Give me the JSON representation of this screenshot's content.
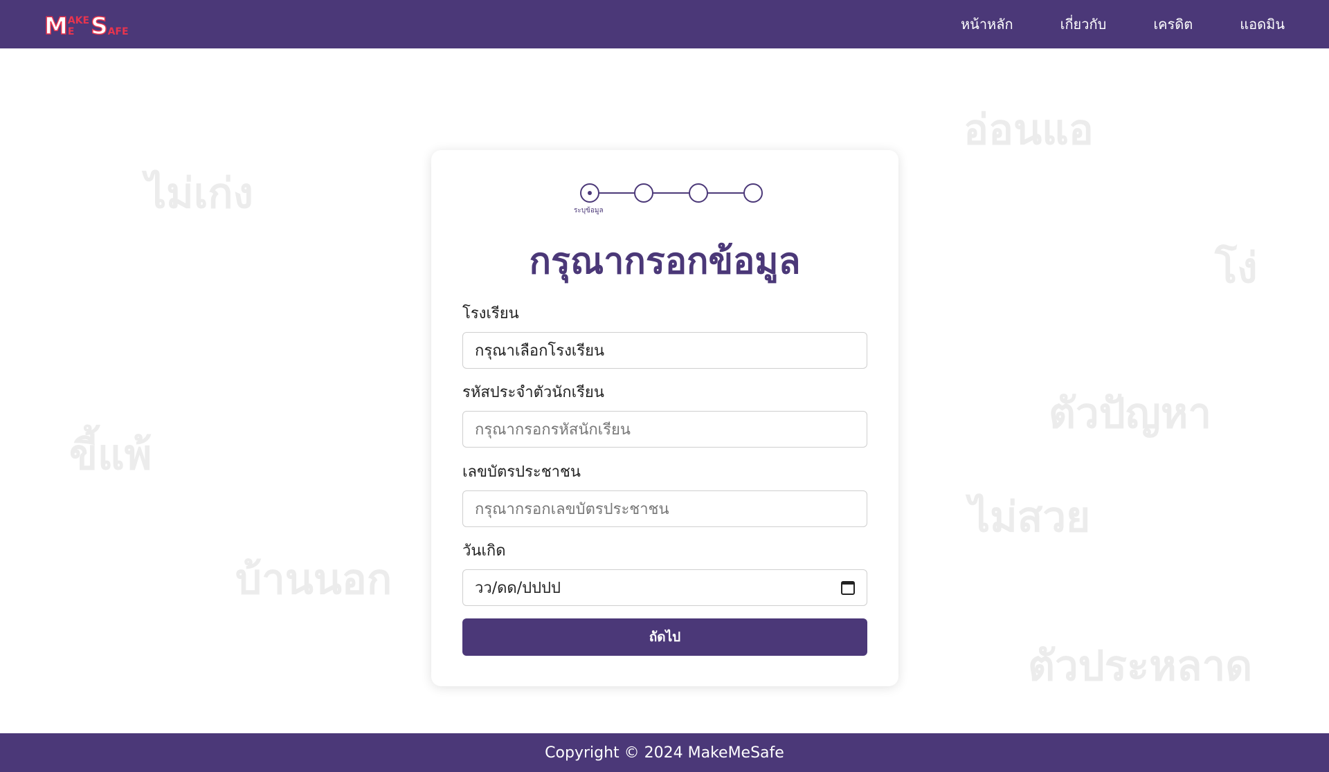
{
  "header": {
    "logo": {
      "m": "M",
      "ake": "AKE",
      "e_small": "E",
      "s": "S",
      "afe": "AFE"
    },
    "nav": [
      {
        "label": "หน้าหลัก"
      },
      {
        "label": "เกี่ยวกับ"
      },
      {
        "label": "เครดิต"
      },
      {
        "label": "แอดมิน"
      }
    ]
  },
  "background_words": [
    "ไม่เก่ง",
    "อ่อนแอ",
    "โง่",
    "ตัวปัญหา",
    "ขี้แพ้",
    "ไม่สวย",
    "บ้านนอก",
    "ตัวประหลาด"
  ],
  "stepper": {
    "steps": 4,
    "current": 1,
    "current_label": "ระบุข้อมูล"
  },
  "form": {
    "title": "กรุณากรอกข้อมูล",
    "school_label": "โรงเรียน",
    "school_value": "กรุณาเลือกโรงเรียน",
    "student_id_label": "รหัสประจำตัวนักเรียน",
    "student_id_placeholder": "กรุณากรอกรหัสนักเรียน",
    "citizen_id_label": "เลขบัตรประชาชน",
    "citizen_id_placeholder": "กรุณากรอกเลขบัตรประชาชน",
    "birthdate_label": "วันเกิด",
    "birthdate_placeholder": "วว/ดด/ปปปป",
    "submit_label": "ถัดไป"
  },
  "footer": {
    "copyright": "Copyright © 2024 MakeMeSafe"
  },
  "colors": {
    "primary": "#4b3878",
    "logo_accent": "#e8344e"
  }
}
